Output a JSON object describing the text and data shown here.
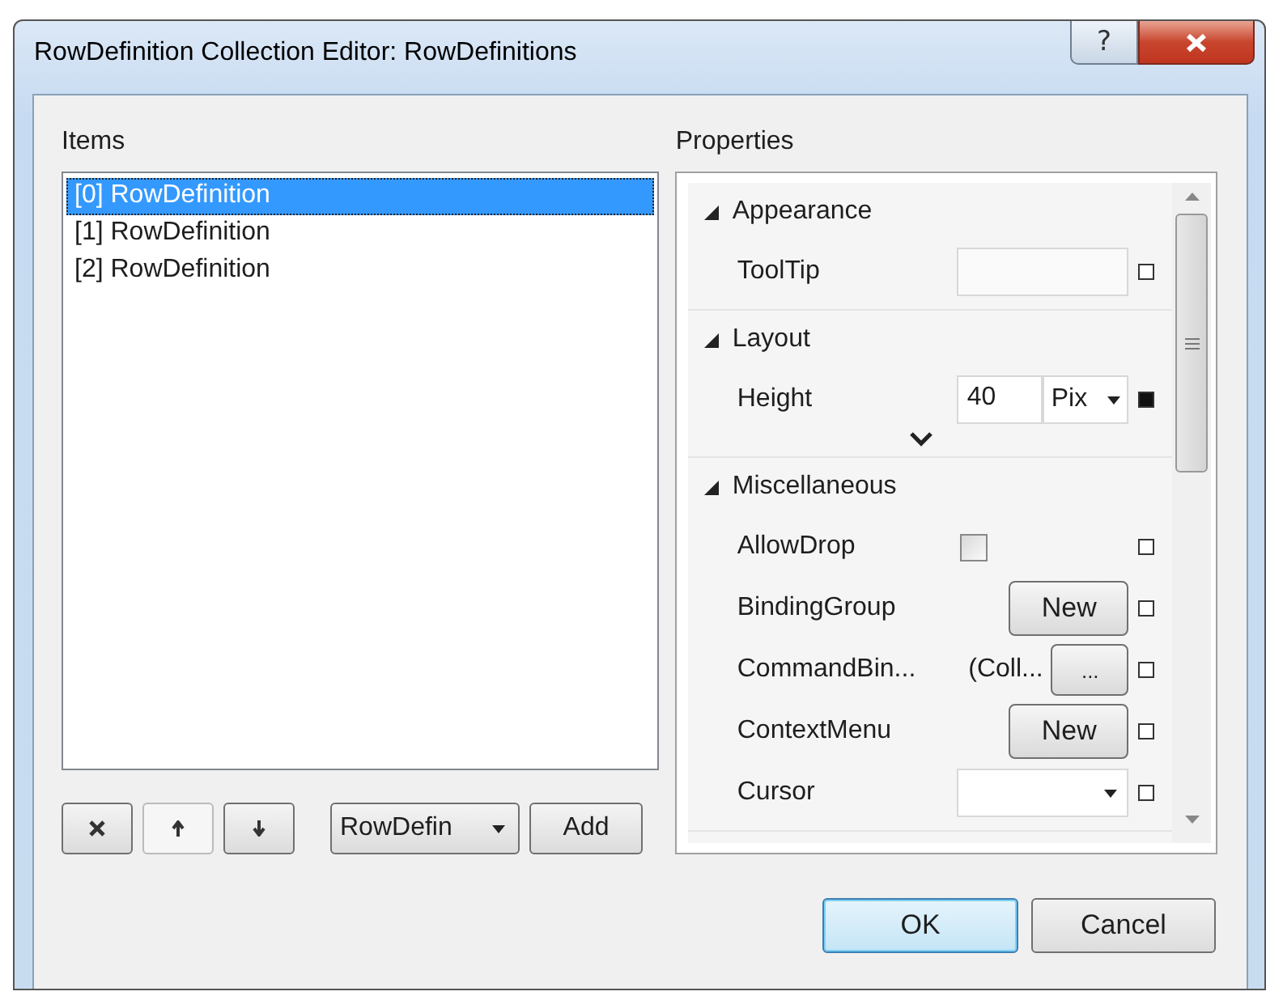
{
  "window": {
    "title": "RowDefinition Collection Editor: RowDefinitions",
    "help": "?"
  },
  "items": {
    "label": "Items",
    "list": [
      {
        "text": "[0] RowDefinition",
        "selected": true
      },
      {
        "text": "[1] RowDefinition",
        "selected": false
      },
      {
        "text": "[2] RowDefinition",
        "selected": false
      }
    ],
    "toolbar": [
      {
        "kind": "remove",
        "disabled": false
      },
      {
        "kind": "up",
        "disabled": true
      },
      {
        "kind": "down",
        "disabled": false
      }
    ],
    "type_dropdown": "RowDefin",
    "add_button": "Add"
  },
  "properties": {
    "label": "Properties",
    "sections": [
      {
        "name": "Appearance",
        "expanded": true,
        "has_more": false,
        "properties": [
          {
            "name": "ToolTip",
            "kind": "text",
            "set": false
          }
        ]
      },
      {
        "name": "Layout",
        "expanded": true,
        "has_more": true,
        "properties": [
          {
            "name": "Height",
            "kind": "unit",
            "value": "40",
            "unit": "Pix",
            "set": true
          }
        ]
      },
      {
        "name": "Miscellaneous",
        "expanded": true,
        "has_more": false,
        "properties": [
          {
            "name": "AllowDrop",
            "kind": "checkbox",
            "checked": false,
            "set": false
          },
          {
            "name": "BindingGroup",
            "kind": "new",
            "button": "New",
            "set": false
          },
          {
            "name": "CommandBin...",
            "kind": "collection",
            "value": "(Coll...",
            "button": "...",
            "set": false
          },
          {
            "name": "ContextMenu",
            "kind": "new",
            "button": "New",
            "set": false
          },
          {
            "name": "Cursor",
            "kind": "dropdown",
            "set": false
          }
        ]
      }
    ]
  },
  "footer": {
    "ok": "OK",
    "cancel": "Cancel"
  }
}
